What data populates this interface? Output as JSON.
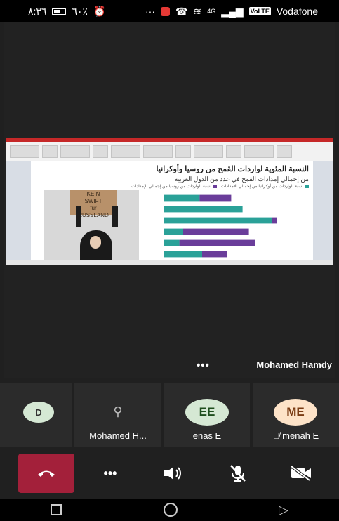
{
  "status": {
    "time": "٨:٣٦",
    "battery": "٦٠٪",
    "carrier": "Vodafone",
    "net_type": "4G",
    "volte": "VoLTE"
  },
  "slide": {
    "title": "النسبة المئوية لواردات القمح من روسيا وأوكرانيا",
    "subtitle": "من إجمالي إمدادات القمح في عدد من الدول العربية",
    "legend": [
      {
        "label": "نسبة الواردات من أوكرانيا من إجمالي الإمدادات",
        "color": "#2aa198"
      },
      {
        "label": "نسبة الواردات من روسيا من إجمالي الإمدادات",
        "color": "#6a3d9a"
      }
    ],
    "sign_text": [
      "KEIN",
      "SWIFT",
      "für",
      "RUSSLAND"
    ]
  },
  "chart_data": {
    "type": "bar",
    "orientation": "horizontal",
    "stacked": true,
    "categories": [
      "",
      "",
      "",
      "",
      "",
      ""
    ],
    "series": [
      {
        "name": "نسبة الواردات من أوكرانيا من إجمالي الإمدادات",
        "values": [
          28,
          62,
          85,
          15,
          12,
          30
        ]
      },
      {
        "name": "نسبة الواردات من روسيا من إجمالي الإمدادات",
        "values": [
          25,
          0,
          4,
          52,
          60,
          20
        ]
      }
    ],
    "title": "النسبة المئوية لواردات القمح من روسيا وأوكرانيا",
    "xlim": [
      0,
      100
    ]
  },
  "meeting": {
    "active_speaker": "Mohamed Hamdy",
    "more_dots": "•••"
  },
  "participants": [
    {
      "initials": "D",
      "name": "",
      "avatar_bg": "#d5e8d4",
      "avatar_fg": "#333333",
      "muted": false
    },
    {
      "initials": "",
      "name": "Mohamed H...",
      "avatar_bg": "#2b2b2b",
      "avatar_fg": "#bbbbbb",
      "muted": false
    },
    {
      "initials": "EE",
      "name": "enas E",
      "avatar_bg": "#d5e8d4",
      "avatar_fg": "#1e4e1e",
      "muted": false
    },
    {
      "initials": "ME",
      "name": "menah E",
      "avatar_bg": "#fde3c8",
      "avatar_fg": "#7a3c13",
      "muted": true
    }
  ],
  "controls": {
    "end_call_color": "#a3203a",
    "more_dots": "•••"
  }
}
